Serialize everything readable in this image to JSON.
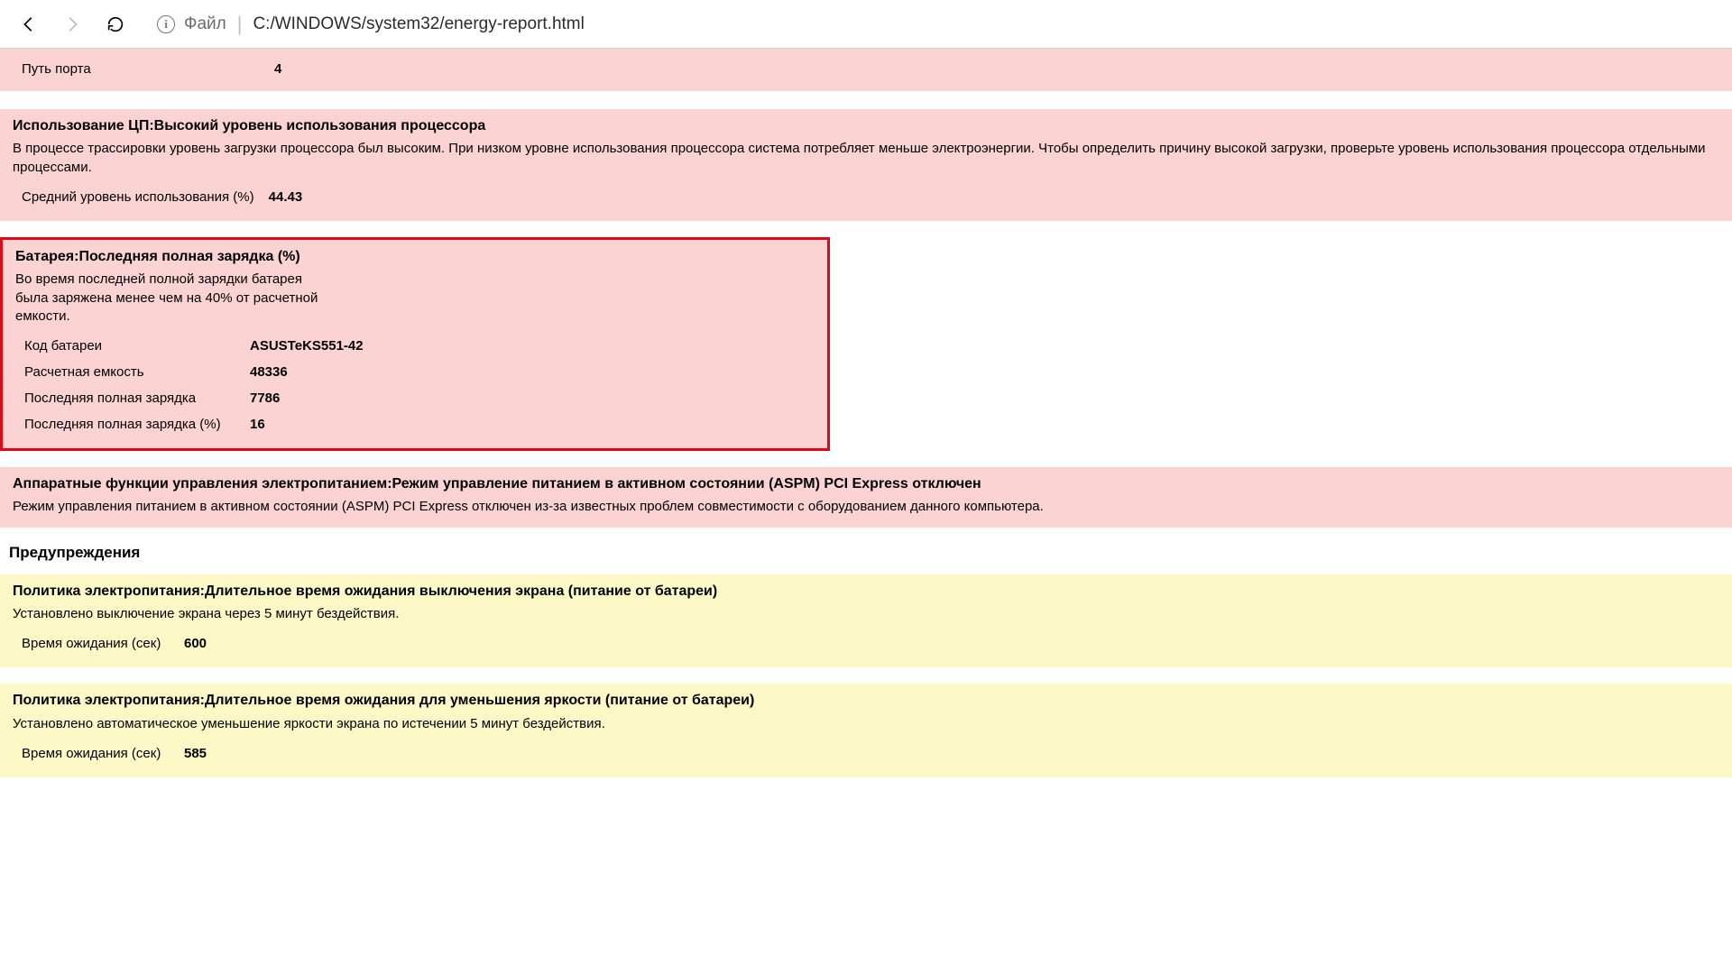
{
  "browser": {
    "file_label": "Файл",
    "path": "C:/WINDOWS/system32/energy-report.html"
  },
  "sections": {
    "port": {
      "rows": [
        {
          "k": "Путь порта",
          "v": "4"
        }
      ]
    },
    "cpu": {
      "title": "Использование ЦП:Высокий уровень использования процессора",
      "desc": "В процессе трассировки уровень загрузки процессора был высоким. При низком уровне использования процессора система потребляет меньше электроэнергии. Чтобы определить причину высокой загрузки, проверьте уровень использования процессора отдельными процессами.",
      "rows": [
        {
          "k": "Средний уровень использования (%)",
          "v": "44.43"
        }
      ]
    },
    "battery": {
      "title": "Батарея:Последняя полная зарядка (%)",
      "desc": "Во время последней полной зарядки батарея была заряжена менее чем на 40% от расчетной емкости.",
      "rows": [
        {
          "k": "Код батареи",
          "v": "ASUSTeKS551-42"
        },
        {
          "k": "Расчетная емкость",
          "v": "48336"
        },
        {
          "k": "Последняя полная зарядка",
          "v": "7786"
        },
        {
          "k": "Последняя полная зарядка (%)",
          "v": "16"
        }
      ]
    },
    "aspm": {
      "title": "Аппаратные функции управления электропитанием:Режим управление питанием в активном состоянии (ASPM) PCI Express отключен",
      "desc": "Режим управления питанием в активном состоянии (ASPM) PCI Express отключен из-за известных проблем совместимости с оборудованием данного компьютера."
    },
    "warnings_heading": "Предупреждения",
    "warn1": {
      "title": "Политика электропитания:Длительное время ожидания выключения экрана (питание от батареи)",
      "desc": "Установлено выключение экрана через 5 минут бездействия.",
      "rows": [
        {
          "k": "Время ожидания (сек)",
          "v": "600"
        }
      ]
    },
    "warn2": {
      "title": "Политика электропитания:Длительное время ожидания для уменьшения яркости (питание от батареи)",
      "desc": "Установлено автоматическое уменьшение яркости экрана по истечении 5 минут бездействия.",
      "rows": [
        {
          "k": "Время ожидания (сек)",
          "v": "585"
        }
      ]
    }
  }
}
